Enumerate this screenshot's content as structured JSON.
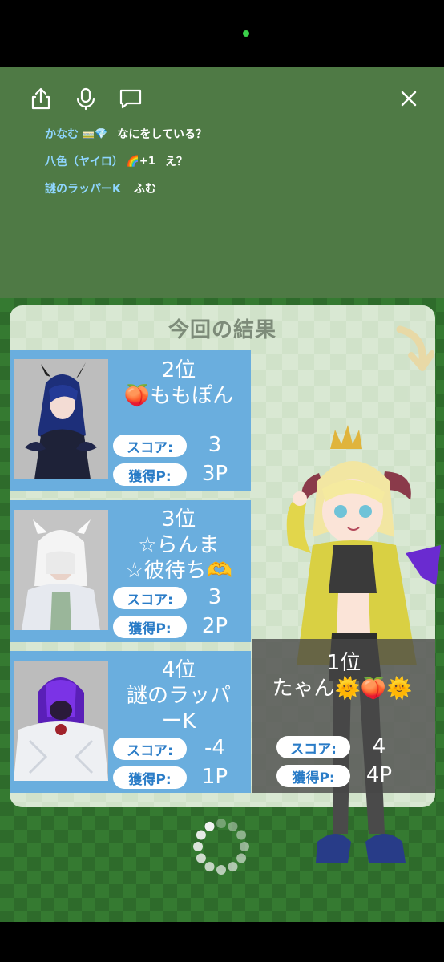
{
  "top_icons": [
    "share-icon",
    "microphone-icon",
    "comment-icon",
    "close-icon"
  ],
  "chat": [
    {
      "name": "かなむ",
      "badge": "🚃💎",
      "message": "なにをしている？"
    },
    {
      "name": "八色（ヤイロ）",
      "badge": "🌈+1",
      "message": "え？"
    },
    {
      "name": "謎のラッパーK",
      "badge": "",
      "message": "ふむ"
    }
  ],
  "results": {
    "title": "今回の結果",
    "score_label": "スコア:",
    "points_label": "獲得P:",
    "ranks": [
      {
        "rank": "2位",
        "name_line1": "🍑ももぽん",
        "name_line2": "",
        "score": "3",
        "points": "3P"
      },
      {
        "rank": "3位",
        "name_line1": "☆らんま",
        "name_line2": "☆彼待ち🫶",
        "score": "3",
        "points": "2P"
      },
      {
        "rank": "4位",
        "name_line1": "謎のラッパ",
        "name_line2": "ーK",
        "score": "-4",
        "points": "1P"
      }
    ],
    "first": {
      "rank": "1位",
      "name": "たゃん🌞🍑🌞",
      "score": "4",
      "points": "4P"
    }
  },
  "colors": {
    "card": "#6aaede",
    "panel": "#d9e8d3",
    "chat_name": "#8fd6ff",
    "game_bg": "#357a31"
  }
}
